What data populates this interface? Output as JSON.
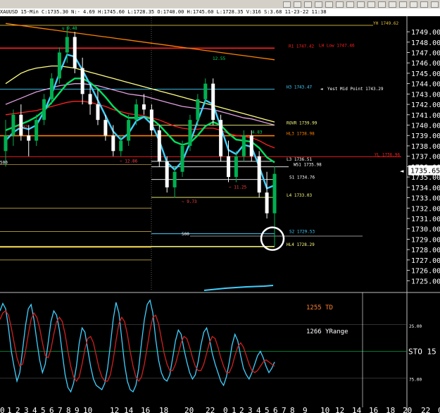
{
  "toolbar": {
    "buttons": [
      "chart-icon",
      "bars-icon",
      "zoom-icon",
      "grid-icon",
      "lines-icon",
      "eye-icon",
      "cross-icon",
      "plus-icon",
      "circle-icon",
      "window-icon",
      "pen-icon",
      "text-icon",
      "arrow-icon",
      "gear-icon",
      "close-icon"
    ]
  },
  "infobar": {
    "text": "XAUUSD 15-Min C:1735.30 N:- 4.69 H:1745.60 L:1728.35 O:1740.00 H:1745.60 L:1728.35 V:316 S:3.68 11-23-22 11:38"
  },
  "colors": {
    "bg": "#000000",
    "up": "#00b050",
    "down": "#ffffff",
    "cyan": "#40d0ff",
    "white": "#ffffff",
    "green": "#00e060",
    "greenDark": "#00a040",
    "pink": "#e0a0e0",
    "red": "#ff2020",
    "orange": "#ff8000",
    "yellow": "#ffff80",
    "gold": "#e0c040",
    "olive": "#808000",
    "peach": "#ffb070",
    "label": "#ffff00"
  },
  "chart_data": [
    {
      "type": "candlestick",
      "title": "XAUUSD 15-Min",
      "ylim": [
        1724.0,
        1750.5
      ],
      "yticks": [
        1725.0,
        1726.0,
        1727.0,
        1728.0,
        1729.0,
        1730.0,
        1731.0,
        1732.0,
        1733.0,
        1734.0,
        1735.0,
        1736.0,
        1737.0,
        1738.0,
        1739.0,
        1740.0,
        1741.0,
        1742.0,
        1743.0,
        1744.0,
        1745.0,
        1746.0,
        1747.0,
        1748.0,
        1749.0
      ],
      "last_price": "1735.65",
      "xticks": [
        "0",
        "1",
        "2",
        "3",
        "4",
        "5",
        "6",
        "7",
        "8",
        "9",
        "10",
        "12",
        "14",
        "16",
        "18",
        "20",
        "22",
        "0",
        "1",
        "2",
        "3",
        "4",
        "5",
        "6",
        "7",
        "8",
        "9",
        "10",
        "12",
        "14",
        "16",
        "18",
        "20",
        "22",
        "0"
      ],
      "levels": [
        {
          "label": "YH 1749.62",
          "price": 1749.62,
          "color": "#e0c040"
        },
        {
          "label": "R1 1747.42",
          "price": 1747.42,
          "color": "#ff2020"
        },
        {
          "label": "LH Low 1747.46",
          "price": 1747.46,
          "color": "#ff2020"
        },
        {
          "label": "H3 1743.47",
          "price": 1743.47,
          "color": "#40d0ff"
        },
        {
          "label": "Yest Mid Point 1743.29",
          "price": 1743.29,
          "color": "#ffffff"
        },
        {
          "label": "ROVR 1739.99",
          "price": 1739.99,
          "color": "#ffff80"
        },
        {
          "label": "HL3 1738.98",
          "price": 1738.98,
          "color": "#ff8000"
        },
        {
          "label": "YL 1736.96",
          "price": 1736.96,
          "color": "#ff2020"
        },
        {
          "label": "L3 1736.51",
          "price": 1736.51,
          "color": "#ffffff"
        },
        {
          "label": "WS1 1735.98",
          "price": 1735.98,
          "color": "#ffffff"
        },
        {
          "label": "S1 1734.76",
          "price": 1734.76,
          "color": "#ffffff"
        },
        {
          "label": "L4 1733.03",
          "price": 1733.03,
          "color": "#ffff80"
        },
        {
          "label": "S2 1729.53",
          "price": 1729.53,
          "color": "#40d0ff"
        },
        {
          "label": "HL4 1728.29",
          "price": 1728.29,
          "color": "#ffff80"
        }
      ],
      "annotations": [
        {
          "text": "u 9.48",
          "color": "#00e060"
        },
        {
          "text": "12.55",
          "color": "#00e060"
        },
        {
          "text": "4.83",
          "color": "#00e060"
        },
        {
          "text": "~ 5.32",
          "color": "#ff4040"
        },
        {
          "text": "~ 12.86",
          "color": "#ff4040"
        },
        {
          "text": "~ 9.73",
          "color": "#ff4040"
        },
        {
          "text": "~ 11.25",
          "color": "#ff4040"
        },
        {
          "text": "500",
          "color": "#ffffff"
        },
        {
          "text": "500",
          "color": "#ffffff"
        }
      ],
      "candles": [
        [
          1737.5,
          1740.5,
          1736.0,
          1739.0
        ],
        [
          1739.0,
          1741.5,
          1738.0,
          1741.0
        ],
        [
          1741.0,
          1742.0,
          1738.5,
          1739.0
        ],
        [
          1739.0,
          1740.0,
          1737.0,
          1738.5
        ],
        [
          1738.5,
          1741.0,
          1738.0,
          1740.5
        ],
        [
          1740.5,
          1743.0,
          1740.0,
          1742.5
        ],
        [
          1742.5,
          1745.0,
          1742.0,
          1744.5
        ],
        [
          1744.5,
          1747.5,
          1744.0,
          1747.0
        ],
        [
          1747.0,
          1749.5,
          1746.0,
          1748.5
        ],
        [
          1748.5,
          1749.0,
          1745.0,
          1745.5
        ],
        [
          1745.5,
          1746.5,
          1742.0,
          1743.0
        ],
        [
          1743.0,
          1744.0,
          1741.0,
          1742.0
        ],
        [
          1742.0,
          1743.5,
          1740.0,
          1740.5
        ],
        [
          1740.5,
          1741.0,
          1738.5,
          1739.0
        ],
        [
          1739.0,
          1740.0,
          1737.0,
          1737.5
        ],
        [
          1737.5,
          1739.0,
          1737.0,
          1738.5
        ],
        [
          1738.5,
          1741.0,
          1738.0,
          1740.5
        ],
        [
          1740.5,
          1742.5,
          1740.0,
          1742.0
        ],
        [
          1742.0,
          1743.0,
          1741.0,
          1741.5
        ],
        [
          1741.5,
          1742.0,
          1739.0,
          1739.5
        ],
        [
          1739.5,
          1740.0,
          1736.0,
          1736.5
        ],
        [
          1736.5,
          1737.0,
          1733.5,
          1734.0
        ],
        [
          1734.0,
          1736.0,
          1733.0,
          1735.5
        ],
        [
          1735.5,
          1738.5,
          1735.0,
          1738.0
        ],
        [
          1738.0,
          1741.0,
          1737.5,
          1740.5
        ],
        [
          1740.5,
          1743.0,
          1740.0,
          1742.5
        ],
        [
          1742.5,
          1744.5,
          1742.0,
          1744.0
        ],
        [
          1744.0,
          1744.5,
          1740.0,
          1740.5
        ],
        [
          1740.5,
          1741.0,
          1736.5,
          1737.0
        ],
        [
          1737.0,
          1738.5,
          1734.5,
          1735.0
        ],
        [
          1735.0,
          1737.5,
          1734.5,
          1737.0
        ],
        [
          1737.0,
          1739.5,
          1736.5,
          1739.0
        ],
        [
          1739.0,
          1739.5,
          1736.5,
          1737.0
        ],
        [
          1737.0,
          1737.5,
          1733.0,
          1733.5
        ],
        [
          1733.5,
          1735.5,
          1731.0,
          1731.5
        ],
        [
          1731.5,
          1736.0,
          1728.35,
          1735.3
        ]
      ],
      "moving_averages": [
        {
          "color": "#ffff80",
          "values": [
            1744.0,
            1744.5,
            1745.0,
            1745.3,
            1745.5,
            1745.6,
            1745.7,
            1745.7,
            1745.6,
            1745.5,
            1745.3,
            1745.1,
            1744.9,
            1744.7,
            1744.5,
            1744.3,
            1744.1,
            1743.9,
            1743.7,
            1743.5,
            1743.3,
            1743.1,
            1742.9,
            1742.7,
            1742.5,
            1742.3,
            1742.1,
            1741.9,
            1741.7,
            1741.5,
            1741.3,
            1741.1,
            1740.9,
            1740.7,
            1740.5,
            1740.3
          ]
        },
        {
          "color": "#ff8000",
          "values": [
            1749.8,
            1749.7,
            1749.6,
            1749.5,
            1749.4,
            1749.3,
            1749.2,
            1749.1,
            1749.0,
            1748.9,
            1748.8,
            1748.7,
            1748.6,
            1748.5,
            1748.4,
            1748.3,
            1748.2,
            1748.1,
            1748.0,
            1747.9,
            1747.8,
            1747.7,
            1747.6,
            1747.5,
            1747.4,
            1747.3,
            1747.2,
            1747.1,
            1747.0,
            1746.9,
            1746.8,
            1746.7,
            1746.6,
            1746.5,
            1746.4,
            1746.3
          ]
        },
        {
          "color": "#e0a0e0",
          "values": [
            1742.0,
            1742.3,
            1742.6,
            1742.9,
            1743.2,
            1743.4,
            1743.6,
            1743.8,
            1743.9,
            1744.0,
            1744.0,
            1743.9,
            1743.8,
            1743.6,
            1743.4,
            1743.2,
            1743.0,
            1742.9,
            1742.8,
            1742.6,
            1742.4,
            1742.2,
            1742.0,
            1741.8,
            1741.7,
            1741.6,
            1741.6,
            1741.5,
            1741.3,
            1741.1,
            1740.9,
            1740.7,
            1740.6,
            1740.4,
            1740.2,
            1740.0
          ]
        },
        {
          "color": "#ff2020",
          "values": [
            1741.0,
            1741.1,
            1741.2,
            1741.3,
            1741.4,
            1741.6,
            1741.8,
            1742.0,
            1742.2,
            1742.3,
            1742.3,
            1742.2,
            1742.0,
            1741.8,
            1741.5,
            1741.3,
            1741.1,
            1741.0,
            1740.9,
            1740.7,
            1740.5,
            1740.2,
            1739.9,
            1739.7,
            1739.6,
            1739.6,
            1739.7,
            1739.7,
            1739.5,
            1739.2,
            1739.0,
            1738.9,
            1738.8,
            1738.5,
            1738.1,
            1737.8
          ]
        },
        {
          "color": "#00e060",
          "values": [
            1739.5,
            1739.8,
            1740.1,
            1740.4,
            1740.8,
            1741.4,
            1742.2,
            1743.1,
            1744.0,
            1744.5,
            1744.5,
            1744.1,
            1743.5,
            1742.7,
            1741.8,
            1741.1,
            1740.7,
            1740.7,
            1740.8,
            1740.6,
            1740.0,
            1739.2,
            1738.4,
            1738.1,
            1738.3,
            1739.0,
            1739.9,
            1740.3,
            1740.0,
            1739.2,
            1738.6,
            1738.5,
            1738.4,
            1737.8,
            1736.9,
            1736.4
          ]
        },
        {
          "color": "#40d0ff",
          "values": [
            1738.5,
            1739.3,
            1739.8,
            1739.6,
            1740.0,
            1741.3,
            1743.0,
            1745.0,
            1746.8,
            1746.6,
            1745.3,
            1743.9,
            1742.4,
            1740.9,
            1739.4,
            1738.6,
            1739.2,
            1740.4,
            1740.8,
            1740.1,
            1738.5,
            1736.4,
            1735.7,
            1736.5,
            1738.3,
            1740.4,
            1742.4,
            1742.0,
            1739.8,
            1737.6,
            1737.2,
            1738.1,
            1737.9,
            1736.0,
            1733.9,
            1734.2
          ]
        }
      ],
      "volume_line": {
        "color": "#40d0ff"
      }
    },
    {
      "type": "line",
      "title": "STO",
      "ylim": [
        0,
        100
      ],
      "yticks": [
        "25.00",
        "75.00"
      ],
      "texts": [
        "1255 TD",
        "1266 YRange",
        "STO 15"
      ],
      "series": [
        {
          "color": "#40d0ff",
          "values": [
            88,
            95,
            90,
            72,
            50,
            35,
            22,
            30,
            52,
            74,
            90,
            94,
            80,
            60,
            42,
            30,
            38,
            58,
            78,
            88,
            84,
            70,
            48,
            28,
            16,
            12,
            20,
            36,
            58,
            72,
            68,
            52,
            36,
            24,
            18,
            16,
            14,
            20,
            34,
            56,
            80,
            96,
            86,
            62,
            38,
            22,
            14,
            12,
            18,
            34,
            58,
            80,
            94,
            98,
            86,
            62,
            42,
            30,
            24,
            22,
            28,
            44,
            60,
            70,
            66,
            52,
            40,
            30,
            24,
            28,
            40,
            56,
            68,
            72,
            62,
            48,
            38,
            30,
            22,
            18,
            26,
            40,
            56,
            66,
            60,
            46,
            34,
            28,
            24,
            30,
            38,
            46,
            50,
            44,
            36,
            30,
            34,
            40
          ]
        },
        {
          "color": "#d02020",
          "values": [
            80,
            86,
            88,
            84,
            72,
            58,
            44,
            36,
            38,
            50,
            66,
            80,
            86,
            82,
            72,
            58,
            46,
            44,
            52,
            66,
            78,
            82,
            78,
            66,
            50,
            36,
            26,
            22,
            26,
            38,
            52,
            62,
            64,
            58,
            46,
            34,
            26,
            22,
            22,
            28,
            42,
            60,
            76,
            82,
            78,
            66,
            50,
            36,
            26,
            22,
            26,
            38,
            54,
            70,
            82,
            84,
            76,
            62,
            48,
            38,
            32,
            32,
            38,
            48,
            58,
            64,
            62,
            54,
            44,
            36,
            32,
            32,
            38,
            48,
            58,
            64,
            62,
            54,
            44,
            36,
            30,
            30,
            36,
            46,
            54,
            58,
            54,
            46,
            38,
            32,
            30,
            32,
            36,
            40,
            42,
            40,
            38,
            36
          ]
        }
      ]
    }
  ]
}
